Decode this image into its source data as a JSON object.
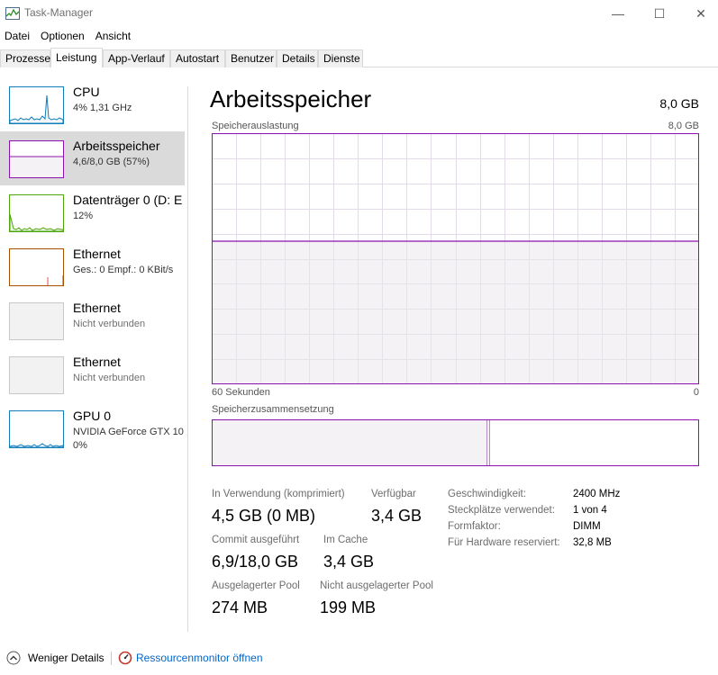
{
  "window": {
    "title": "Task-Manager",
    "controls": {
      "minimize": "—",
      "maximize": "☐",
      "close": "✕"
    }
  },
  "menu": [
    "Datei",
    "Optionen",
    "Ansicht"
  ],
  "tabs": [
    "Prozesse",
    "Leistung",
    "App-Verlauf",
    "Autostart",
    "Benutzer",
    "Details",
    "Dienste"
  ],
  "active_tab": "Leistung",
  "sidebar": {
    "items": [
      {
        "title": "CPU",
        "sub1": "4%  1,31 GHz",
        "color": "#117dbb"
      },
      {
        "title": "Arbeitsspeicher",
        "sub1": "4,6/8,0 GB (57%)",
        "color": "#8b12ae",
        "selected": true
      },
      {
        "title": "Datenträger 0 (D: E",
        "sub1": "12%",
        "color": "#4da60c"
      },
      {
        "title": "Ethernet",
        "sub1": "Ges.: 0  Empf.: 0 KBit/s",
        "color": "#a74f01"
      },
      {
        "title": "Ethernet",
        "sub1": "Nicht verbunden",
        "color": "#c8c8c8"
      },
      {
        "title": "Ethernet",
        "sub1": "Nicht verbunden",
        "color": "#c8c8c8"
      },
      {
        "title": "GPU 0",
        "sub1": "NVIDIA GeForce GTX 10",
        "sub2": "0%",
        "color": "#117dbb"
      }
    ]
  },
  "main": {
    "title": "Arbeitsspeicher",
    "total": "8,0 GB",
    "usage_chart": {
      "label": "Speicherauslastung",
      "max_label": "8,0 GB",
      "x_left": "60 Sekunden",
      "x_right": "0",
      "usage_fraction": 0.57,
      "color": "#8b12ae",
      "fill": "#f4f2f4"
    },
    "composition": {
      "label": "Speicherzusammensetzung",
      "in_use_fraction": 0.57
    },
    "stats": {
      "in_use_label": "In Verwendung (komprimiert)",
      "in_use_value": "4,5 GB (0 MB)",
      "available_label": "Verfügbar",
      "available_value": "3,4 GB",
      "commit_label": "Commit ausgeführt",
      "commit_value": "6,9/18,0 GB",
      "cache_label": "Im Cache",
      "cache_value": "3,4 GB",
      "paged_label": "Ausgelagerter Pool",
      "paged_value": "274 MB",
      "nonpaged_label": "Nicht ausgelagerter Pool",
      "nonpaged_value": "199 MB"
    },
    "details": [
      {
        "label": "Geschwindigkeit:",
        "value": "2400 MHz"
      },
      {
        "label": "Steckplätze verwendet:",
        "value": "1 von 4"
      },
      {
        "label": "Formfaktor:",
        "value": "DIMM"
      },
      {
        "label": "Für Hardware reserviert:",
        "value": "32,8 MB"
      }
    ]
  },
  "footer": {
    "fewer_details": "Weniger Details",
    "resource_monitor": "Ressourcenmonitor öffnen"
  }
}
